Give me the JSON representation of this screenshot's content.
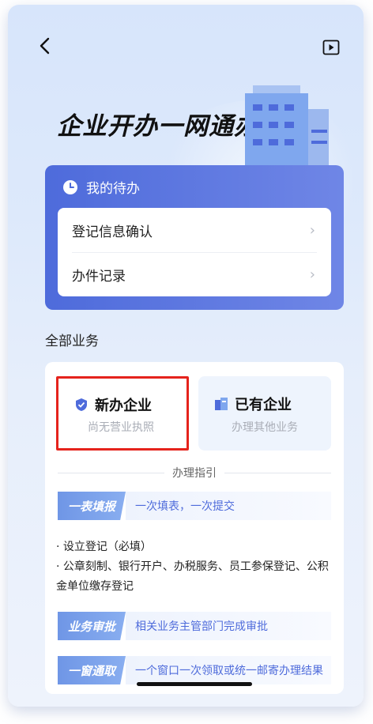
{
  "header": {
    "title": "企业开办一网通办"
  },
  "todo": {
    "title": "我的待办",
    "items": [
      {
        "label": "登记信息确认"
      },
      {
        "label": "办件记录"
      }
    ]
  },
  "business": {
    "section_title": "全部业务",
    "tiles": [
      {
        "title": "新办企业",
        "subtitle": "尚无营业执照"
      },
      {
        "title": "已有企业",
        "subtitle": "办理其他业务"
      }
    ],
    "guide_title": "办理指引",
    "steps": [
      {
        "tag": "一表填报",
        "desc": "一次填表，一次提交"
      },
      {
        "tag": "业务审批",
        "desc": "相关业务主管部门完成审批"
      },
      {
        "tag": "一窗通取",
        "desc": "一个窗口一次领取或统一邮寄办理结果"
      }
    ],
    "details": [
      "· 设立登记（必填）",
      "· 公章刻制、银行开户、办税服务、员工参保登记、公积金单位缴存登记"
    ]
  },
  "colors": {
    "accent": "#4e6bdb",
    "highlight": "#e5231c"
  }
}
